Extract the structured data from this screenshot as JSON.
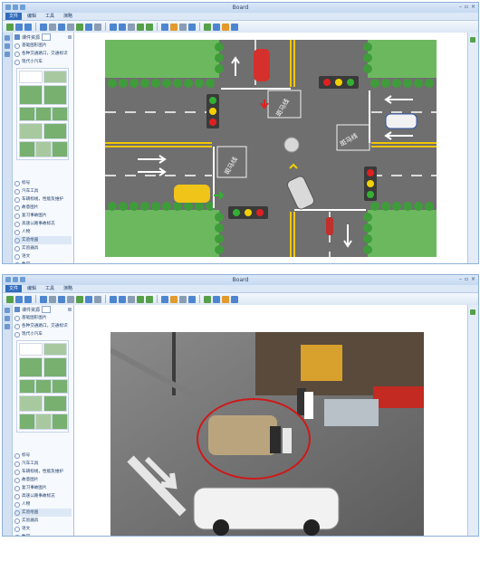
{
  "app": {
    "title": "Board",
    "window_controls": [
      "–",
      "▫",
      "×"
    ]
  },
  "menu": {
    "tabs": [
      {
        "label": "文件",
        "active": true
      },
      {
        "label": "编辑",
        "active": false
      },
      {
        "label": "工具",
        "active": false
      },
      {
        "label": "演略",
        "active": false
      }
    ]
  },
  "sidebar": {
    "header_label": "课件资源",
    "top_items": [
      {
        "label": "基础图形图片"
      },
      {
        "label": "各种交通路口，交通标识"
      },
      {
        "label": "现代小汽车"
      }
    ],
    "bottom_items": [
      {
        "label": "标号"
      },
      {
        "label": "汽车工具"
      },
      {
        "label": "车辆标线，性能及维护"
      },
      {
        "label": "故意图片"
      },
      {
        "label": "复习事故图片"
      },
      {
        "label": "高速公路事故标志"
      },
      {
        "label": "人物"
      },
      {
        "label": "实验绘画"
      },
      {
        "label": "实验器具"
      },
      {
        "label": "语文"
      },
      {
        "label": "数学"
      }
    ]
  },
  "scene": {
    "zebra_text": "斑马线",
    "road_markings": [
      "斑马线",
      "斑马线",
      "斑马线",
      "斑马线"
    ]
  },
  "colors": {
    "accent": "#2f6bbd",
    "grass": "#6cb85f",
    "road": "#6f6f6f",
    "lane_yellow": "#f2c500",
    "light_red": "#e02020",
    "light_yellow": "#f4d000",
    "light_green": "#33b033"
  }
}
